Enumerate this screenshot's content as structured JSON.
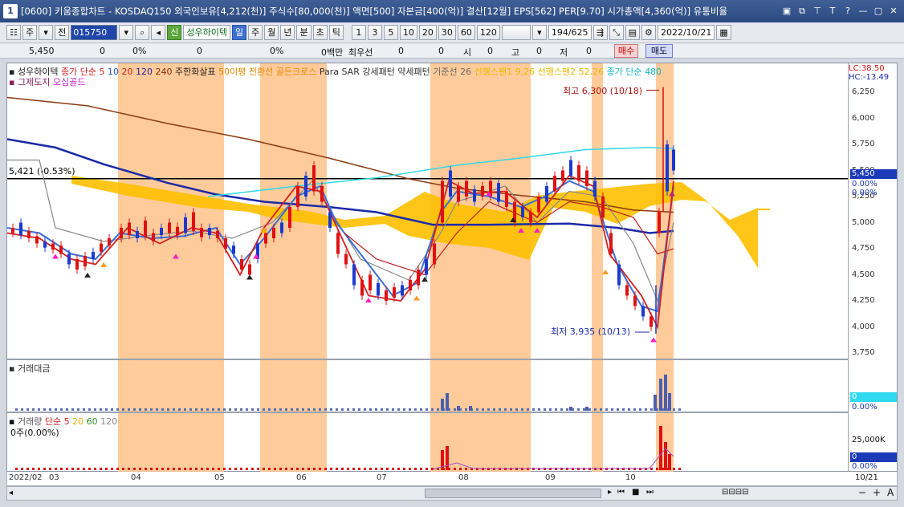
{
  "window": {
    "number": "1",
    "title": "[0600] 키움종합차트 - KOSDAQ150 외국인보유[4,212(천)] 주식수[80,000(천)] 액면[500] 자본금[400(억)] 결산[12월] EPS[562] PER[9.70] 시가총액[4,360(억)] 유통비율"
  },
  "toolbar": {
    "type_label": "주",
    "market_label": "전",
    "code": "015750",
    "credit_label": "신",
    "stock_name": "성우하이텍",
    "periods": [
      "일",
      "주",
      "월",
      "년",
      "분",
      "초",
      "틱"
    ],
    "active_period": "일",
    "intervals": [
      "1",
      "3",
      "5",
      "10",
      "20",
      "30",
      "60",
      "120"
    ],
    "count": "194/625",
    "date": "2022/10/21"
  },
  "infobar": {
    "price": "5,450",
    "change": "0",
    "change_pct": "0%",
    "volume": "0",
    "volume_pct": "0%",
    "amount_label": "0백만",
    "priority_label": "최우선",
    "best": "0",
    "open_label": "시",
    "open": "0",
    "high_label": "고",
    "high": "0",
    "low_label": "저",
    "low": "0",
    "buy_label": "매수",
    "sell_label": "매도"
  },
  "legend": {
    "line1": [
      {
        "text": "성우하이텍",
        "color": "#222222"
      },
      {
        "text": "종가 단순",
        "color": "#d02020"
      },
      {
        "text": "5",
        "color": "#d02020"
      },
      {
        "text": "10",
        "color": "#2050d0"
      },
      {
        "text": "20",
        "color": "#d02020"
      },
      {
        "text": "120",
        "color": "#2020a0"
      },
      {
        "text": "240",
        "color": "#8b2a00"
      },
      {
        "text": "주한화살표",
        "color": "#222222"
      },
      {
        "text": "50이평 전환선 골든크로스",
        "color": "#e88a00"
      },
      {
        "text": "Para SAR 강세패턴",
        "color": "#333333"
      },
      {
        "text": "약세패턴",
        "color": "#333333"
      },
      {
        "text": "기준선 26",
        "color": "#666666"
      },
      {
        "text": "선행스팬1 9,26",
        "color": "#e8b800"
      },
      {
        "text": "선행스팬2 52,26",
        "color": "#e8b800"
      },
      {
        "text": "종가 단순 480",
        "color": "#10b8c8"
      }
    ],
    "line2": [
      {
        "text": "그제도지",
        "color": "#8a2060"
      },
      {
        "text": "오십골드",
        "color": "#c020c0"
      }
    ]
  },
  "price_axis": {
    "ticks": [
      "6,250",
      "6,000",
      "5,750",
      "5,500",
      "5,250",
      "5,000",
      "4,750",
      "4,500",
      "4,250",
      "4,000",
      "3,750"
    ],
    "lc": "LC:38.50",
    "hc": "HC:-13.49",
    "current": "5,450",
    "current_pct": "0.00%",
    "current_pct2": "0.00%"
  },
  "annotations": {
    "high": "최고 6,300 (10/18)",
    "low": "최저 3,935 (10/13)",
    "hline": "5,421 (-0.53%)"
  },
  "volume_pane": {
    "title": "거래대금",
    "value": "0",
    "pct": "0.00%"
  },
  "qty_pane": {
    "title": "거래량",
    "subtitle": "단순",
    "ma": [
      "5",
      "20",
      "60",
      "120"
    ],
    "sub": "0주(0.00%)",
    "axis": "25,000K",
    "value": "0",
    "pct": "0.00%"
  },
  "x_axis": {
    "labels": [
      "2022/02",
      "03",
      "04",
      "05",
      "06",
      "07",
      "08",
      "09",
      "10"
    ],
    "right_label": "10/21"
  },
  "colors": {
    "band": "#ffc28a",
    "cloud": "#ffc000",
    "ma5": "#d52020",
    "ma10": "#3a6ed8",
    "ma120": "#1a2aa8",
    "ma240": "#8b3a10",
    "ma480": "#30d8e8",
    "base": "#888888"
  }
}
